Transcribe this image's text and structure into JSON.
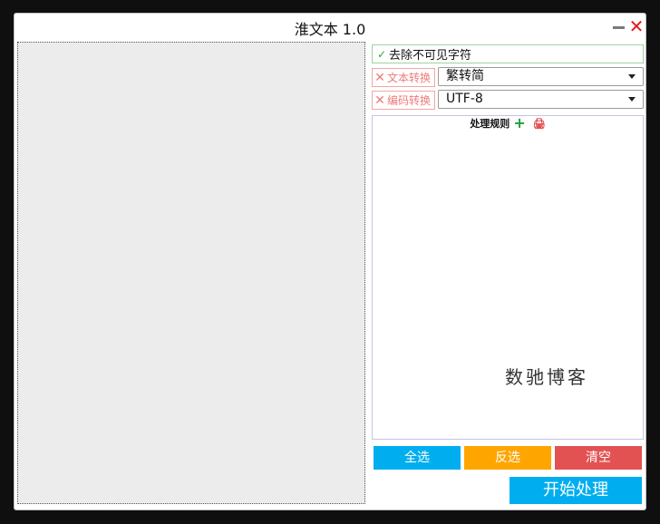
{
  "window": {
    "title": "淮文本 1.0",
    "close_symbol": "✕"
  },
  "options": {
    "remove_invisible": {
      "label": "去除不可见字符",
      "checked": true,
      "check_symbol": "✓"
    }
  },
  "text_convert": {
    "toggle_label": "文本转换",
    "enabled": false,
    "x_symbol": "✕",
    "selected": "繁转简"
  },
  "encoding_convert": {
    "toggle_label": "编码转换",
    "enabled": false,
    "x_symbol": "✕",
    "selected": "UTF-8"
  },
  "rules": {
    "header": "处理规则",
    "add_symbol": "+",
    "delete_symbol": "🖨",
    "watermark": "数驰博客"
  },
  "buttons": {
    "select_all": "全选",
    "invert": "反选",
    "clear": "清空",
    "start": "开始处理"
  },
  "colors": {
    "blue": "#00aeef",
    "orange": "#ffa500",
    "red": "#e35252"
  }
}
